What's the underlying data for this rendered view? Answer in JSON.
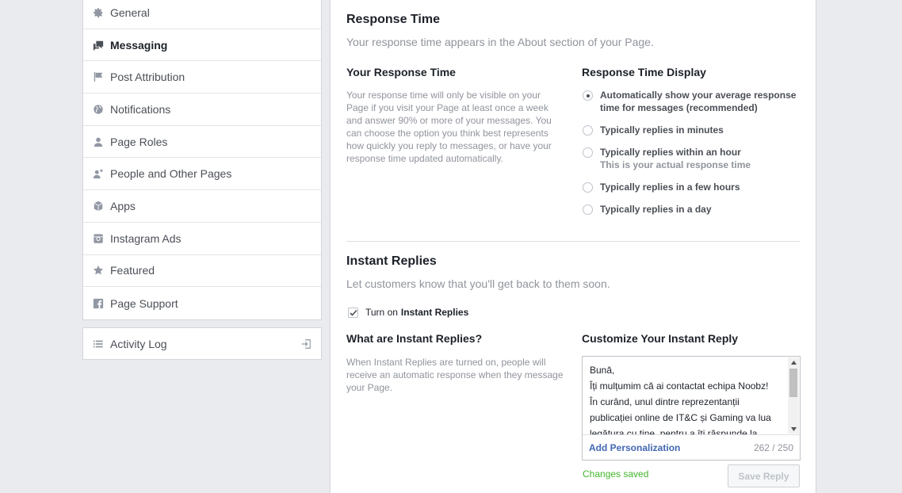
{
  "sidebar": {
    "items": [
      {
        "label": "General",
        "icon": "gear-icon"
      },
      {
        "label": "Messaging",
        "icon": "messaging-icon",
        "active": true
      },
      {
        "label": "Post Attribution",
        "icon": "flag-icon"
      },
      {
        "label": "Notifications",
        "icon": "globe-icon"
      },
      {
        "label": "Page Roles",
        "icon": "person-icon"
      },
      {
        "label": "People and Other Pages",
        "icon": "person-star-icon"
      },
      {
        "label": "Apps",
        "icon": "cube-icon"
      },
      {
        "label": "Instagram Ads",
        "icon": "instagram-icon"
      },
      {
        "label": "Featured",
        "icon": "star-icon"
      },
      {
        "label": "Page Support",
        "icon": "facebook-icon"
      }
    ],
    "activity_log": "Activity Log"
  },
  "response_time": {
    "title": "Response Time",
    "subtitle": "Your response time appears in the About section of your Page.",
    "your_title": "Your Response Time",
    "your_desc": "Your response time will only be visible on your Page if you visit your Page at least once a week and answer 90% or more of your messages. You can choose the option you think best represents how quickly you reply to messages, or have your response time updated automatically.",
    "display_title": "Response Time Display",
    "options": [
      {
        "label": "Automatically show your average response time for messages (recommended)",
        "checked": true
      },
      {
        "label": "Typically replies in minutes",
        "checked": false
      },
      {
        "label": "Typically replies within an hour",
        "note": "This is your actual response time",
        "checked": false
      },
      {
        "label": "Typically replies in a few hours",
        "checked": false
      },
      {
        "label": "Typically replies in a day",
        "checked": false
      }
    ]
  },
  "instant_replies": {
    "title": "Instant Replies",
    "subtitle": "Let customers know that you'll get back to them soon.",
    "toggle_prefix": "Turn on",
    "toggle_bold": "Instant Replies",
    "toggle_checked": true,
    "what_title": "What are Instant Replies?",
    "what_desc": "When Instant Replies are turned on, people will receive an automatic response when they message your Page.",
    "customize_title": "Customize Your Instant Reply",
    "reply_text": "Bună,\nÎți mulțumim că ai contactat echipa Noobz!\nÎn curând, unul dintre reprezentanții publicației online de IT&C și Gaming va lua legătura cu tine, pentru a îți răspunde la",
    "add_personalization": "Add Personalization",
    "counter": "262 / 250",
    "status": "Changes saved",
    "save_label": "Save Reply"
  }
}
